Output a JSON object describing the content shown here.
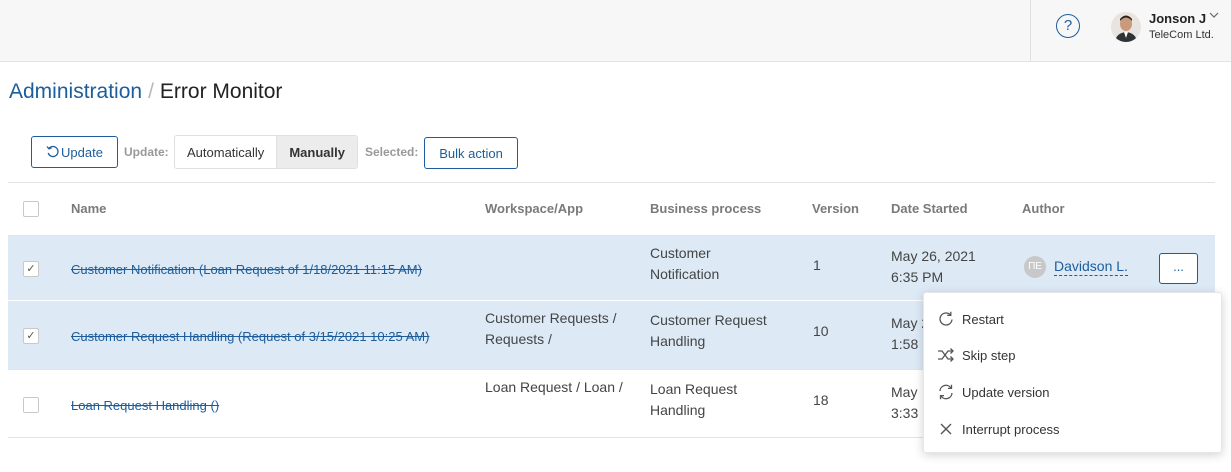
{
  "header": {
    "help_glyph": "?",
    "user_name": "Jonson J",
    "user_company": "TeleCom Ltd."
  },
  "breadcrumb": {
    "parent": "Administration",
    "separator": "/",
    "current": "Error Monitor"
  },
  "toolbar": {
    "update_label": "Update",
    "update_mode_label": "Update:",
    "mode_automatic": "Automatically",
    "mode_manual": "Manually",
    "selected_label": "Selected:",
    "bulk_action_label": "Bulk action"
  },
  "table": {
    "columns": [
      "Name",
      "Workspace/App",
      "Business process",
      "Version",
      "Date Started",
      "Author"
    ],
    "rows": [
      {
        "selected": true,
        "check": "✓",
        "name": "Customer Notification (Loan Request of 1/18/2021 11:15 AM)",
        "workspace_line1": "",
        "workspace_line2": "",
        "process_line1": "Customer",
        "process_line2": "Notification",
        "version": "1",
        "date_line1": "May 26, 2021",
        "date_line2": "6:35 PM",
        "author_initials": "ПЕ",
        "author_name": "Davidson L.",
        "more_label": "..."
      },
      {
        "selected": true,
        "check": "✓",
        "name": "Customer Request Handling (Request of 3/15/2021 10:25 AM)",
        "workspace_line1": "Customer Requests /",
        "workspace_line2": "Requests /",
        "process_line1": "Customer Request",
        "process_line2": "Handling",
        "version": "10",
        "date_line1": "May 2",
        "date_line2": "1:58"
      },
      {
        "selected": false,
        "check": "",
        "name": "Loan Request Handling ()",
        "workspace_line1": "Loan Request / Loan /",
        "workspace_line2": "",
        "process_line1": "Loan Request",
        "process_line2": "Handling",
        "version": "18",
        "date_line1": "May",
        "date_line2": "3:33"
      }
    ]
  },
  "context_menu": {
    "items": [
      {
        "label": "Restart",
        "icon": "restart-icon"
      },
      {
        "label": "Skip step",
        "icon": "shuffle-icon"
      },
      {
        "label": "Update version",
        "icon": "sync-icon"
      },
      {
        "label": "Interrupt process",
        "icon": "close-icon"
      }
    ]
  },
  "colors": {
    "accent": "#1d5d9b",
    "selected_row": "#ddeaf6"
  }
}
